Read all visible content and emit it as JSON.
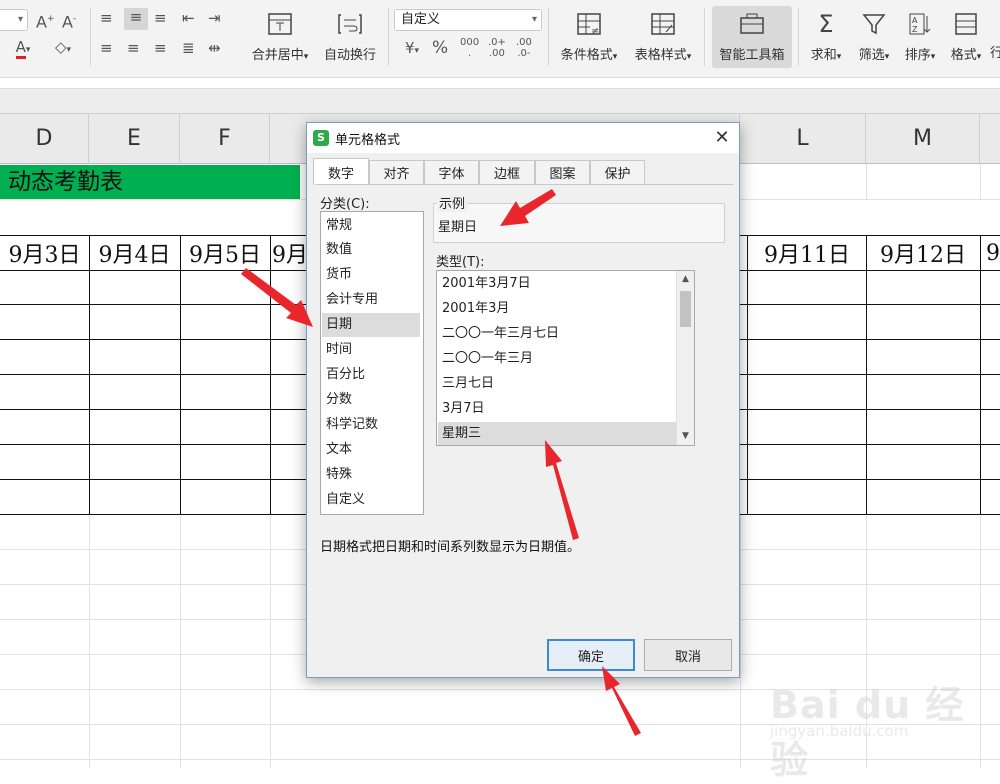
{
  "ribbon": {
    "font_grow": "A⁺",
    "font_shrink": "A⁻",
    "merge_center": "合并居中",
    "wrap_text": "自动换行",
    "number_format": "自定义",
    "conditional_format": "条件格式",
    "table_style": "表格样式",
    "smart_toolbox": "智能工具箱",
    "sum": "求和",
    "filter": "筛选",
    "sort": "排序",
    "format": "格式",
    "more": "行"
  },
  "sheet": {
    "columns": [
      "D",
      "E",
      "F",
      "L",
      "M"
    ],
    "title_cell": "动态考勤表",
    "dates": [
      "9月3日",
      "9月4日",
      "9月5日",
      "9月",
      "9月11日",
      "9月12日",
      "9"
    ]
  },
  "dialog": {
    "title": "单元格格式",
    "logo_letter": "S",
    "close": "✕",
    "tabs": [
      "数字",
      "对齐",
      "字体",
      "边框",
      "图案",
      "保护"
    ],
    "category_label": "分类(C):",
    "categories": [
      "常规",
      "数值",
      "货币",
      "会计专用",
      "日期",
      "时间",
      "百分比",
      "分数",
      "科学记数",
      "文本",
      "特殊",
      "自定义"
    ],
    "selected_category": "日期",
    "sample_label": "示例",
    "sample_value": "星期日",
    "type_label": "类型(T):",
    "types": [
      "2001年3月7日",
      "2001年3月",
      "二〇〇一年三月七日",
      "二〇〇一年三月",
      "三月七日",
      "3月7日",
      "星期三"
    ],
    "selected_type": "星期三",
    "description": "日期格式把日期和时间系列数显示为日期值。",
    "ok": "确定",
    "cancel": "取消"
  },
  "watermark": {
    "brand": "Bai du 经验",
    "url": "jingyan.baidu.com"
  },
  "colors": {
    "title_fill": "#00b050",
    "arrow": "#e8262c",
    "primary_button_border": "#3c8ad6"
  }
}
